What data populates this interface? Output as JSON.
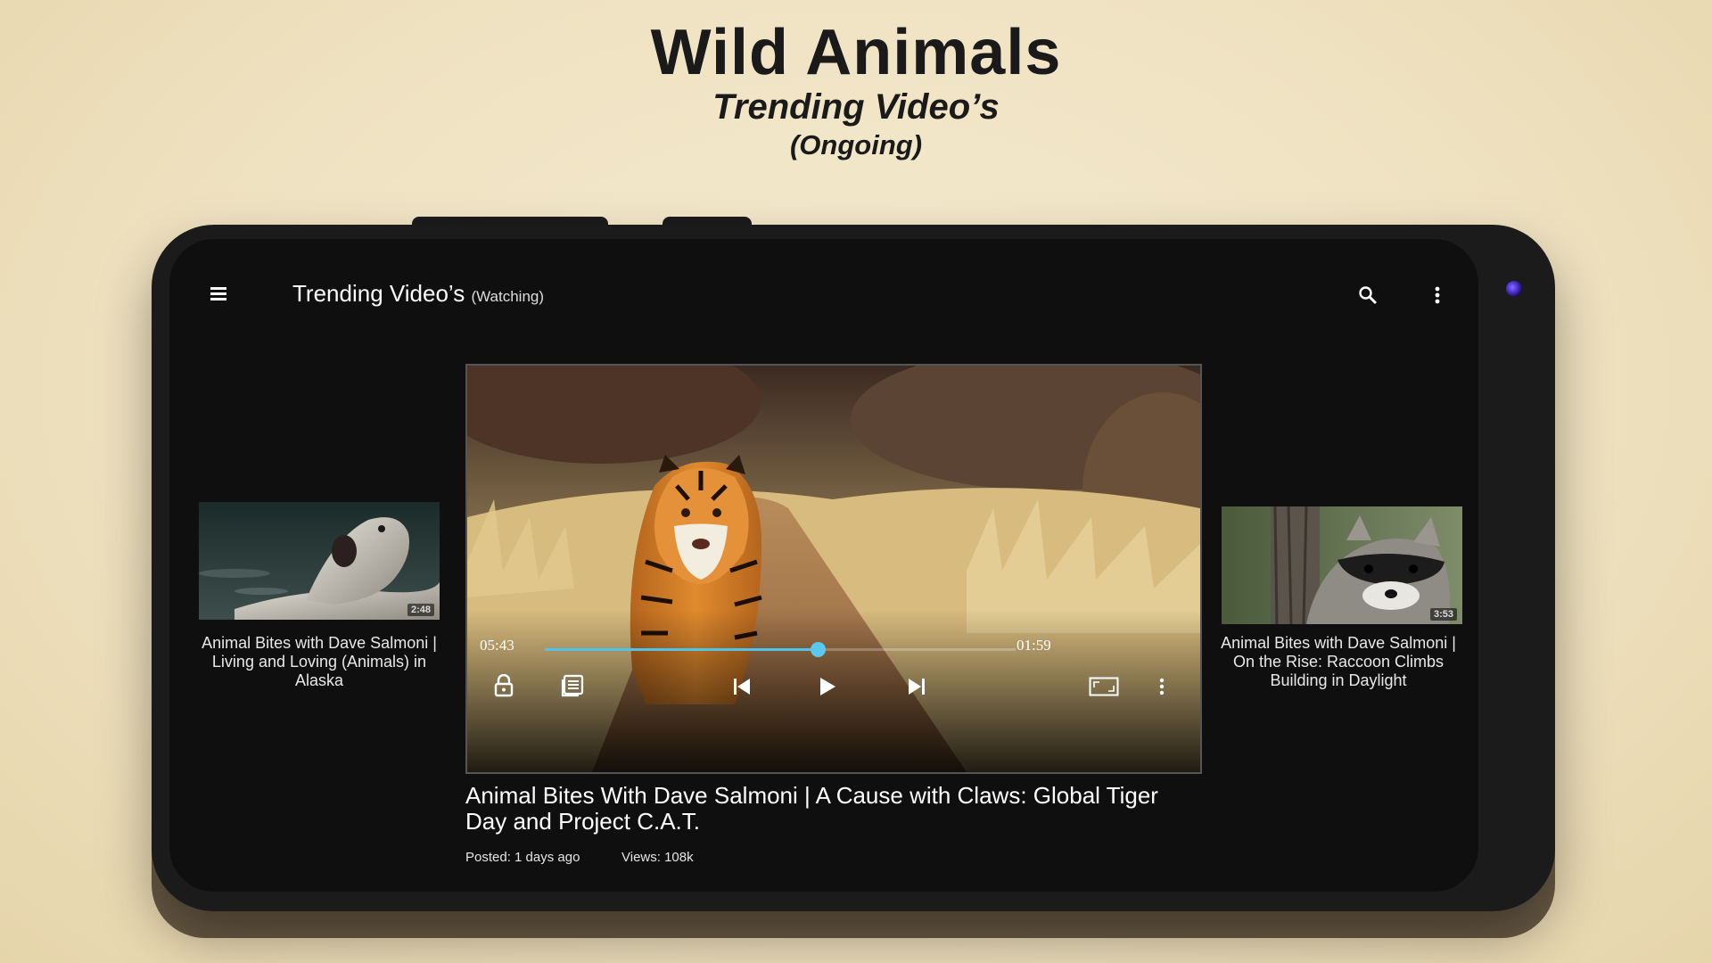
{
  "header": {
    "title": "Wild Animals",
    "subtitle": "Trending Video’s",
    "subtitle2": "(Ongoing)"
  },
  "appbar": {
    "title": "Trending Video’s",
    "title_suffix": "(Watching)"
  },
  "player": {
    "elapsed": "05:43",
    "remaining": "01:59",
    "progress": 0.58
  },
  "left_video": {
    "title": "Animal Bites with Dave Salmoni | Living and Loving (Animals) in Alaska",
    "duration": "2:48"
  },
  "right_video": {
    "title": "Animal Bites with Dave Salmoni | On the Rise: Raccoon Climbs Building in Daylight",
    "duration": "3:53"
  },
  "current_video": {
    "title": "Animal Bites With Dave Salmoni | A Cause with Claws: Global Tiger Day and Project C.A.T.",
    "posted": "Posted: 1 days ago",
    "views": "Views: 108k"
  },
  "colors": {
    "accent": "#4fc3e8",
    "background": "#efe2c1",
    "screen": "#0f0f0f"
  },
  "icons": [
    "menu-icon",
    "search-icon",
    "more-vert-icon",
    "lock-icon",
    "playlist-icon",
    "skip-previous-icon",
    "play-icon",
    "skip-next-icon",
    "fullscreen-icon"
  ]
}
